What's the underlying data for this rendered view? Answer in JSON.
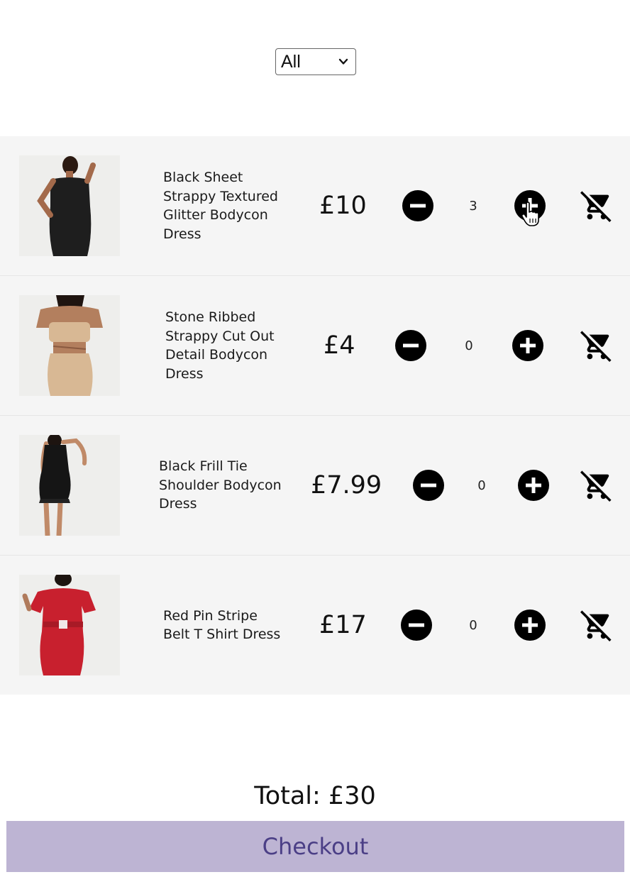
{
  "filter": {
    "selected": "All"
  },
  "products": [
    {
      "name": "Black Sheet Strappy Textured Glitter Bodycon Dress",
      "price": "£10",
      "quantity": "3",
      "image": "black-strappy-glitter-dress"
    },
    {
      "name": "Stone Ribbed Strappy Cut Out Detail Bodycon Dress",
      "price": "£4",
      "quantity": "0",
      "image": "stone-ribbed-cut-out-dress"
    },
    {
      "name": "Black Frill Tie Shoulder Bodycon Dress",
      "price": "£7.99",
      "quantity": "0",
      "image": "black-frill-tie-shoulder-dress"
    },
    {
      "name": "Red Pin Stripe Belt T Shirt Dress",
      "price": "£17",
      "quantity": "0",
      "image": "red-pin-stripe-belt-dress"
    }
  ],
  "icons": {
    "decrement": "minus-circle-icon",
    "increment": "plus-circle-icon",
    "remove": "remove-shopping-cart-icon",
    "dropdown": "chevron-down-icon"
  },
  "total": "Total: £30",
  "checkout_label": "Checkout",
  "colors": {
    "row_background": "#f5f5f5",
    "checkout_background": "#bdb4d3",
    "checkout_text": "#4b3f86"
  }
}
